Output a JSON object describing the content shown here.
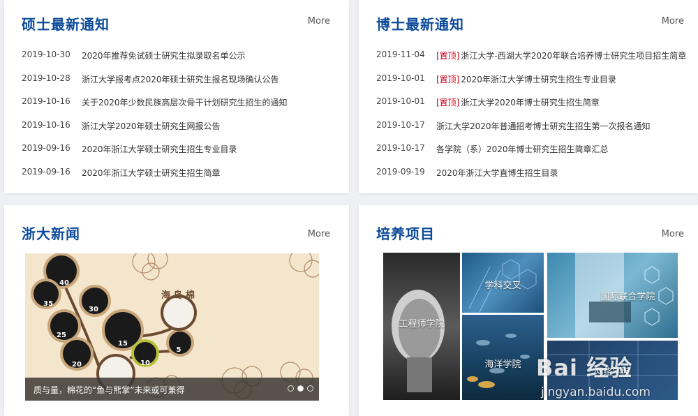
{
  "masters": {
    "title": "硕士最新通知",
    "more": "More",
    "items": [
      {
        "date": "2019-10-30",
        "tag": "",
        "text": "2020年推荐免试硕士研究生拟录取名单公示"
      },
      {
        "date": "2019-10-28",
        "tag": "",
        "text": "浙江大学报考点2020年硕士研究生报名现场确认公告"
      },
      {
        "date": "2019-10-16",
        "tag": "",
        "text": "关于2020年少数民族高层次骨干计划研究生招生的通知"
      },
      {
        "date": "2019-10-16",
        "tag": "",
        "text": "浙江大学2020年硕士研究生网报公告"
      },
      {
        "date": "2019-09-16",
        "tag": "",
        "text": "2020年浙江大学硕士研究生招生专业目录"
      },
      {
        "date": "2019-09-16",
        "tag": "",
        "text": "2020年浙江大学硕士研究生招生简章"
      }
    ]
  },
  "doctors": {
    "title": "博士最新通知",
    "more": "More",
    "items": [
      {
        "date": "2019-11-04",
        "tag": "[置顶]",
        "text": "浙江大学-西湖大学2020年联合培养博士研究生项目招生简章"
      },
      {
        "date": "2019-10-01",
        "tag": "[置顶]",
        "text": "2020年浙江大学博士研究生招生专业目录"
      },
      {
        "date": "2019-10-01",
        "tag": "[置顶]",
        "text": "浙江大学2020年博士研究生招生简章"
      },
      {
        "date": "2019-10-17",
        "tag": "",
        "text": "浙江大学2020年普通招考博士研究生招生第一次报名通知"
      },
      {
        "date": "2019-10-17",
        "tag": "",
        "text": "各学院（系）2020年博士研究生招生简章汇总"
      },
      {
        "date": "2019-09-19",
        "tag": "",
        "text": "2020年浙江大学直博生招生目录"
      }
    ]
  },
  "news": {
    "title": "浙大新闻",
    "more": "More",
    "caption": "质与量，棉花的“鱼与熊掌”未来或可兼得",
    "slides": 3,
    "active_slide": 2,
    "bubble_numbers": [
      "40",
      "35",
      "30",
      "25",
      "20",
      "15",
      "10",
      "5"
    ],
    "bubble_text": "海 岛 棉"
  },
  "projects": {
    "title": "培养项目",
    "more": "More",
    "items": {
      "engineer": "工程师学院",
      "cross": "学科交叉",
      "intl": "国际联合学院",
      "ocean": "海洋学院",
      "fifth": "网络学院"
    }
  },
  "watermark": {
    "brand": "Bai 经验",
    "url": "jingyan.baidu.com"
  },
  "colors": {
    "title_blue": "#0c4b9a",
    "pin_red": "#d0021b"
  }
}
